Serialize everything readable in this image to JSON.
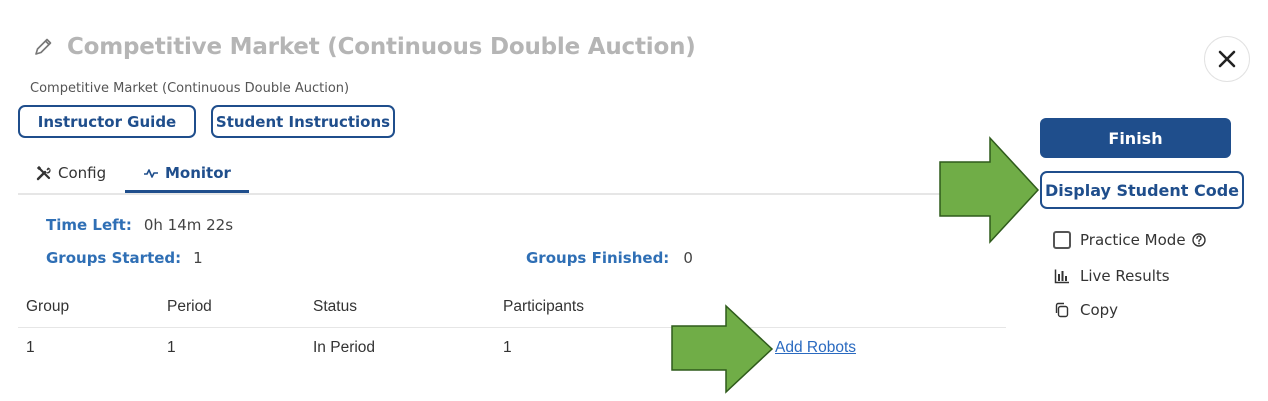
{
  "header": {
    "title": "Competitive Market (Continuous Double Auction)",
    "subtitle": "Competitive Market (Continuous Double Auction)",
    "icons": {
      "edit": "pencil-icon",
      "close": "close-icon"
    }
  },
  "buttons": {
    "instructor_guide": "Instructor Guide",
    "student_instructions": "Student Instructions"
  },
  "tabs": [
    {
      "label": "Config",
      "icon": "tools-icon",
      "active": false
    },
    {
      "label": "Monitor",
      "icon": "pulse-icon",
      "active": true
    }
  ],
  "monitor": {
    "time_left_label": "Time Left:",
    "time_left_value": "0h 14m 22s",
    "groups_started_label": "Groups Started:",
    "groups_started_value": "1",
    "groups_finished_label": "Groups Finished:",
    "groups_finished_value": "0"
  },
  "table": {
    "headers": [
      "Group",
      "Period",
      "Status",
      "Participants"
    ],
    "rows": [
      {
        "cells": [
          "1",
          "1",
          "In Period",
          "1"
        ],
        "action": "Add Robots"
      }
    ]
  },
  "sidebar": {
    "finish": "Finish",
    "display_code": "Display Student Code",
    "practice_mode": "Practice Mode",
    "live_results": "Live Results",
    "copy": "Copy"
  },
  "colors": {
    "primary": "#1f4e8c",
    "label_blue": "#2f6fb5",
    "link": "#2a6ac0",
    "title_gray": "#b5b5b5",
    "arrow_fill": "#70ad47",
    "arrow_stroke": "#2f5b1c"
  }
}
